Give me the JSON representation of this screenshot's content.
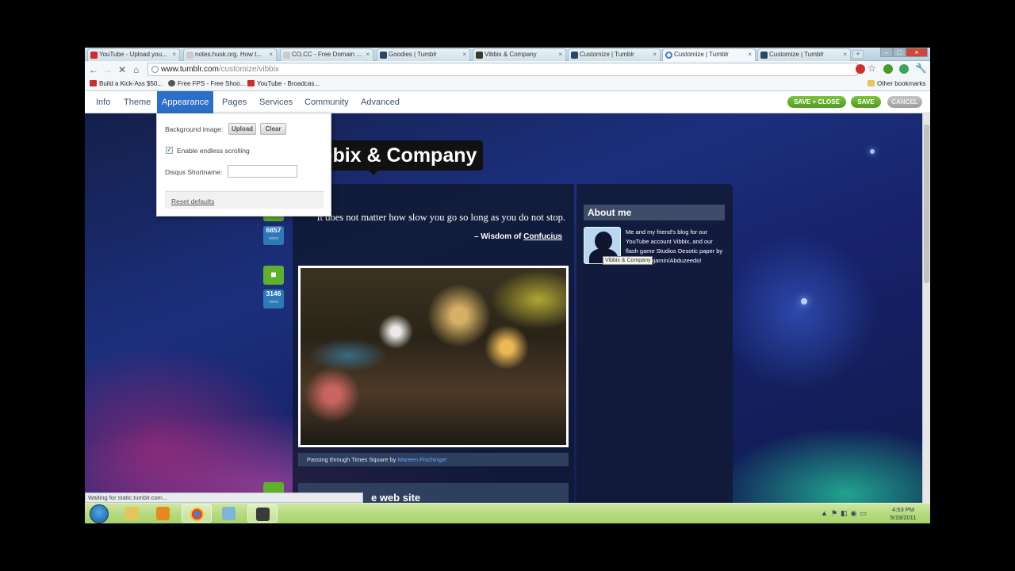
{
  "browser": {
    "tabs": [
      {
        "label": "YouTube - Upload you...",
        "icon": "youtube-icon",
        "active": false
      },
      {
        "label": "notes.husk.org. How t...",
        "icon": "page-icon",
        "active": false
      },
      {
        "label": "CO.CC - Free Domain ...",
        "icon": "page-icon",
        "active": false
      },
      {
        "label": "Goodies | Tumblr",
        "icon": "tumblr-icon",
        "active": false
      },
      {
        "label": "Vibbix & Company",
        "icon": "page-icon",
        "active": false
      },
      {
        "label": "Customize | Tumblr",
        "icon": "tumblr-icon",
        "active": false
      },
      {
        "label": "Customize | Tumblr",
        "icon": "loading-icon",
        "active": true
      },
      {
        "label": "Customize | Tumblr",
        "icon": "tumblr-icon",
        "active": false
      }
    ],
    "url_host": "www.tumblr.com",
    "url_path": "/customize/vibbix",
    "bookmarks": [
      {
        "label": "Build a Kick-Ass $50...",
        "icon": "bookmark-site-icon"
      },
      {
        "label": "Free FPS - Free Shoo...",
        "icon": "bookmark-site-icon"
      },
      {
        "label": "YouTube - Broadcas...",
        "icon": "youtube-icon"
      }
    ],
    "other_bookmarks": "Other bookmarks",
    "status": "Waiting for static.tumblr.com..."
  },
  "customize": {
    "menu": [
      "Info",
      "Theme",
      "Appearance",
      "Pages",
      "Services",
      "Community",
      "Advanced"
    ],
    "active_menu": "Appearance",
    "save_close": "SAVE + CLOSE",
    "save": "SAVE",
    "cancel": "CANCEL",
    "panel": {
      "background_label": "Background image:",
      "upload": "Upload",
      "clear": "Clear",
      "endless_label": "Enable endless scrolling",
      "endless_checked": "✓",
      "disqus_label": "Disqus Shortname:",
      "disqus_value": "",
      "reset": "Reset defaults"
    }
  },
  "blog": {
    "title": "Vibbix & Company",
    "quote": "It does not matter how slow you go so long as you do not stop.",
    "quote_prefix": "– Wisdom of",
    "quote_author": "Confucius",
    "counts": [
      {
        "value": "6857",
        "unit": "notes"
      },
      {
        "value": "3146",
        "unit": "notes"
      }
    ],
    "photo_caption_prefix": "Passing through Times Square by",
    "photo_caption_author": "Mareen Fischinger",
    "next_post_title": "e web site",
    "about_title": "About me",
    "about_text": "Me and my friend's blog for our YouTube account Vibbix, and our flash game Studios Desotic paper by Jason Benjamin/Abduzeedo!",
    "avatar_tooltip": "Vibbix & Company"
  },
  "taskbar": {
    "time": "4:53 PM",
    "date": "5/19/2011"
  },
  "colors": {
    "accent_blue": "#2d6ec9",
    "save_green": "#5fae2a",
    "count_blue": "#2f78b8",
    "tag_green": "#5fb02c",
    "link_blue": "#5aa9ff"
  }
}
